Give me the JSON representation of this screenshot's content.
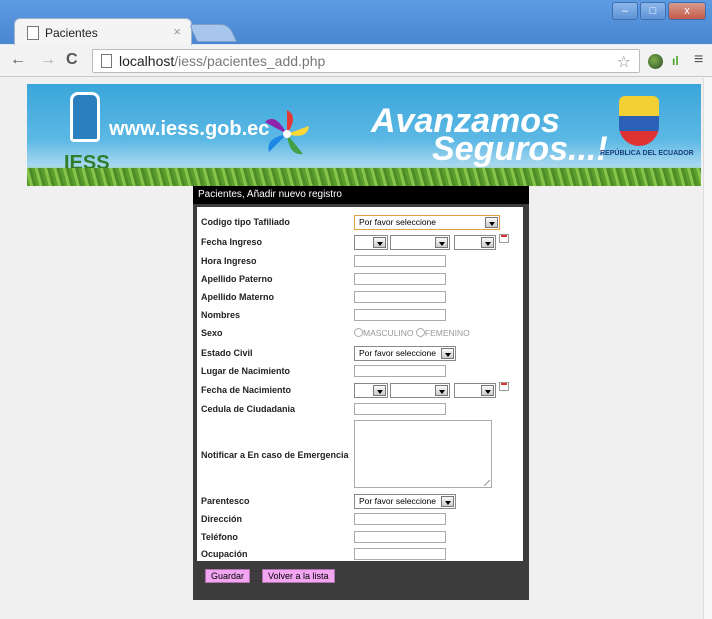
{
  "browser": {
    "tab_title": "Pacientes",
    "tab_close": "×",
    "url_host": "localhost",
    "url_path": "/iess/pacientes_add.php",
    "window_controls": [
      "–",
      "□",
      "x"
    ]
  },
  "banner": {
    "logo_text": "IESS",
    "website": "www.iess.gob.ec",
    "slogan_line1": "Avanzamos",
    "slogan_line2": "Seguros...!",
    "republic": "REPÚBLICA DEL ECUADOR"
  },
  "form": {
    "heading": "Pacientes, Añadir nuevo registro",
    "fields": {
      "tipo_afiliado": {
        "label": "Codigo tipo Tafiliado",
        "value": "Por favor seleccione"
      },
      "fecha_ingreso": {
        "label": "Fecha Ingreso"
      },
      "hora_ingreso": {
        "label": "Hora Ingreso"
      },
      "apellido_paterno": {
        "label": "Apellido Paterno"
      },
      "apellido_materno": {
        "label": "Apellido Materno"
      },
      "nombres": {
        "label": "Nombres"
      },
      "sexo": {
        "label": "Sexo",
        "options": [
          "MASCULINO",
          "FEMENINO"
        ]
      },
      "estado_civil": {
        "label": "Estado Civil",
        "value": "Por favor seleccione"
      },
      "lugar_nacimiento": {
        "label": "Lugar de Nacimiento"
      },
      "fecha_nacimiento": {
        "label": "Fecha de Nacimiento"
      },
      "cedula": {
        "label": "Cedula de Ciudadania"
      },
      "notificar": {
        "label": "Notificar a En caso de Emergencia"
      },
      "parentesco": {
        "label": "Parentesco",
        "value": "Por favor seleccione"
      },
      "direccion": {
        "label": "Dirección"
      },
      "telefono": {
        "label": "Teléfono"
      },
      "ocupacion": {
        "label": "Ocupación"
      }
    },
    "buttons": {
      "save": "Guardar",
      "back": "Volver a la lista"
    }
  },
  "colors": {
    "button_bg": "#f2a6f2",
    "panel_bg": "#3c3c3c",
    "header_bg": "#000000"
  }
}
